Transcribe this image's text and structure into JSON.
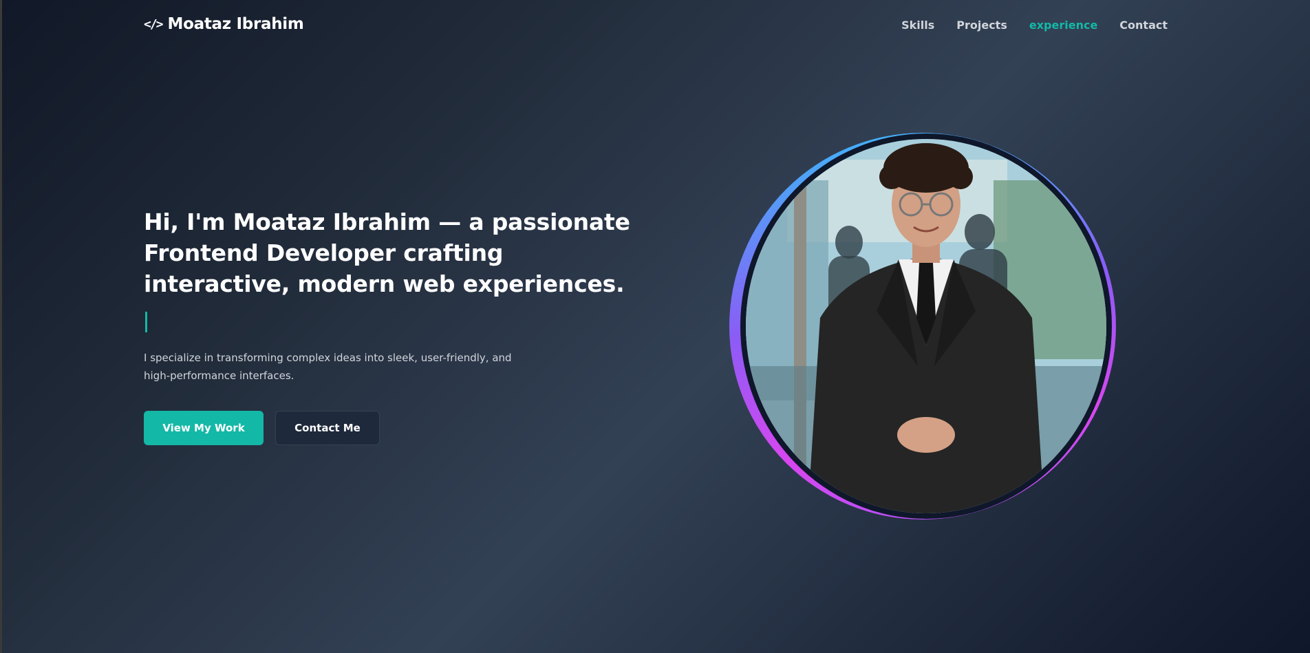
{
  "header": {
    "brand_icon": "</>",
    "brand_name": "Moataz Ibrahim",
    "nav": [
      {
        "label": "Skills",
        "active": false
      },
      {
        "label": "Projects",
        "active": false
      },
      {
        "label": "experience",
        "active": true
      },
      {
        "label": "Contact",
        "active": false
      }
    ]
  },
  "hero": {
    "headline": "Hi, I'm Moataz Ibrahim — a passionate Frontend Developer crafting interactive, modern web experiences.",
    "description": "I specialize in transforming complex ideas into sleek, user-friendly, and high-performance interfaces.",
    "primary_button": "View My Work",
    "secondary_button": "Contact Me"
  },
  "colors": {
    "accent": "#14b8a6",
    "background_dark": "#111827",
    "button_secondary_bg": "#1e293b"
  },
  "portrait": {
    "icon": "portrait-photo"
  }
}
